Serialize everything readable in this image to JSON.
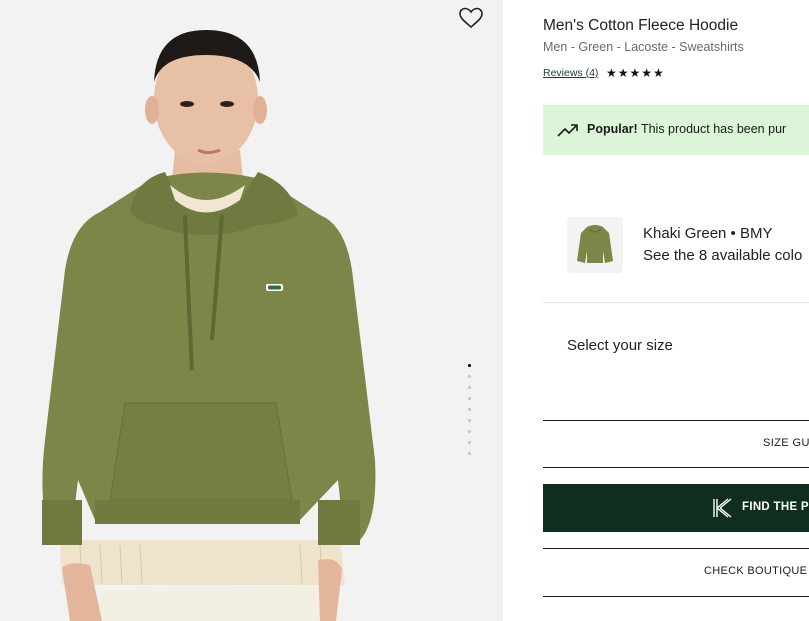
{
  "product": {
    "title": "Men's Cotton Fleece Hoodie",
    "breadcrumb": "Men - Green - Lacoste - Sweatshirts",
    "reviews_label": "Reviews (4)",
    "stars": "★★★★★",
    "rating_out_of_5": 5
  },
  "gallery": {
    "image_count": 9,
    "active_index": 0
  },
  "popular": {
    "bold": "Popular!",
    "text": " This product has been pur"
  },
  "color": {
    "name": "Khaki Green • BMY",
    "more": "See the 8 available colo"
  },
  "size": {
    "label": "Select your size",
    "guide_label": "SIZE GU"
  },
  "actions": {
    "find_label": "FIND THE P",
    "check_label": "CHECK BOUTIQUE"
  },
  "colors": {
    "hoodie": "#7b8648",
    "banner": "#dcf5d9",
    "button_dark": "#0f2e1d"
  },
  "icons": [
    "heart-icon",
    "trending-up-icon",
    "k-logo-icon",
    "star-icon"
  ]
}
